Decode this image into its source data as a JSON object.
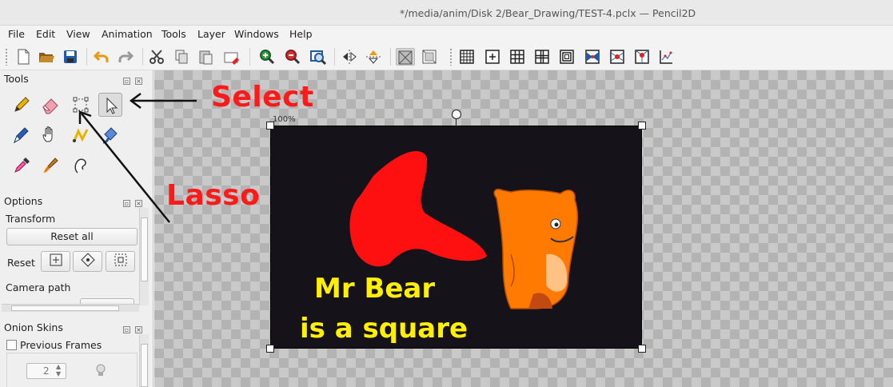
{
  "window": {
    "title": "*/media/anim/Disk 2/Bear_Drawing/TEST-4.pclx — Pencil2D"
  },
  "menu": [
    "File",
    "Edit",
    "View",
    "Animation",
    "Tools",
    "Layer",
    "Windows",
    "Help"
  ],
  "toolbar_icons": [
    "new-file-icon",
    "open-folder-icon",
    "save-icon",
    "undo-icon",
    "redo-icon",
    "cut-icon",
    "copy-icon",
    "paste-icon",
    "clear-icon",
    "zoom-in-icon",
    "zoom-out-icon",
    "zoom-fit-icon",
    "flip-horizontal-icon",
    "flip-vertical-icon",
    "toggle-camera-icon",
    "onion-skin-icon",
    "grid-icon",
    "center-icon",
    "thirds-icon",
    "golden-ratio-icon",
    "safe-area-icon",
    "overlay-icon",
    "perspective-icon",
    "perspective-2-icon",
    "perspective-3-icon",
    "chart-icon"
  ],
  "tools_panel": {
    "title": "Tools",
    "tools": [
      "pencil-icon",
      "eraser-icon",
      "lasso-select-icon",
      "move-select-icon",
      "pen-icon",
      "hand-icon",
      "polyline-icon",
      "bucket-icon",
      "eyedropper-icon",
      "brush-icon",
      "smudge-icon"
    ],
    "selected": "move-select-icon"
  },
  "options_panel": {
    "title": "Options",
    "transform_label": "Transform",
    "reset_all": "Reset all",
    "reset_label": "Reset",
    "camera_path_label": "Camera path"
  },
  "onion_panel": {
    "title": "Onion Skins",
    "previous_frames_label": "Previous Frames",
    "previous_frames_checked": false,
    "frames_value": "2"
  },
  "canvas": {
    "zoom_label": "100%",
    "caption_line1": "Mr Bear",
    "caption_line2": "is a square",
    "colors": {
      "background": "#151219",
      "caption": "#ffef00",
      "shape": "#ff1010",
      "bear": "#ff7a00"
    }
  },
  "annotations": {
    "select_label": "Select",
    "lasso_label": "Lasso",
    "color": "#ff1a1a"
  }
}
